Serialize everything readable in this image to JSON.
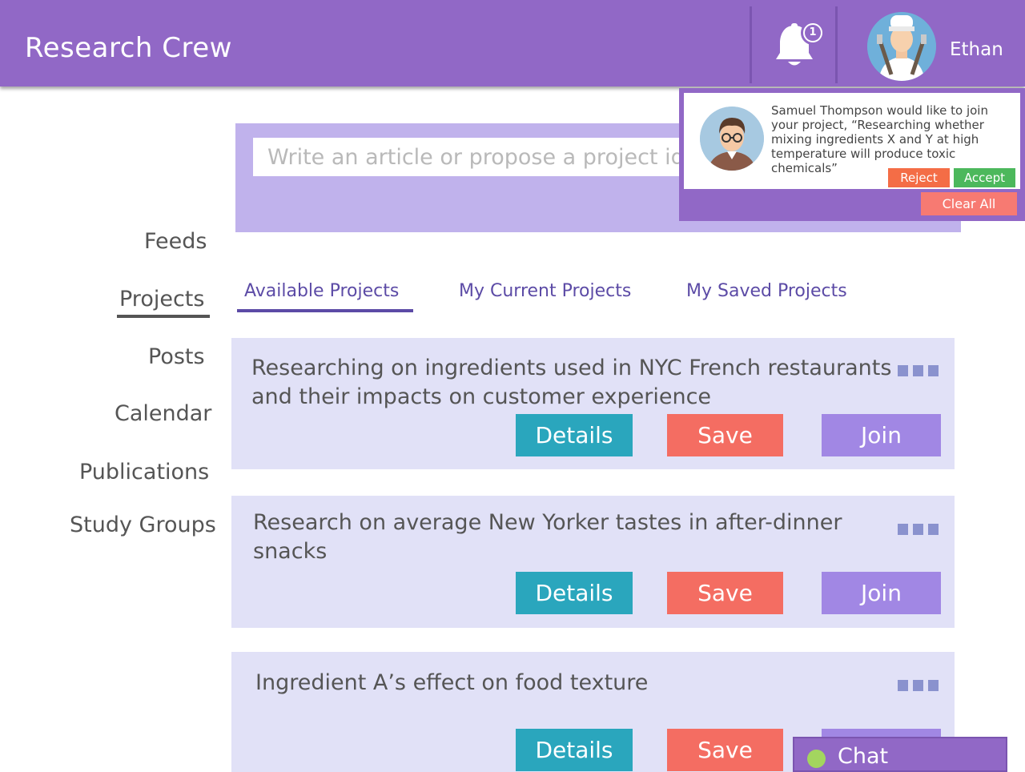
{
  "header": {
    "brand": "Research Crew",
    "notification_count": "1",
    "user_name": "Ethan"
  },
  "composer": {
    "placeholder": "Write an article or propose a project idea"
  },
  "sidebar": {
    "items": [
      {
        "label": "Feeds"
      },
      {
        "label": "Projects",
        "active": true
      },
      {
        "label": "Posts"
      },
      {
        "label": "Calendar"
      },
      {
        "label": "Publications"
      },
      {
        "label": "Study Groups"
      }
    ]
  },
  "tabs": [
    {
      "label": "Available Projects",
      "active": true
    },
    {
      "label": "My Current Projects"
    },
    {
      "label": "My Saved Projects"
    }
  ],
  "projects": [
    {
      "title": "Researching on ingredients used in NYC French restaurants and their impacts on customer experience",
      "details": "Details",
      "save": "Save",
      "join": "Join"
    },
    {
      "title": "Research on average New Yorker tastes in after-dinner snacks",
      "details": "Details",
      "save": "Save",
      "join": "Join"
    },
    {
      "title": "Ingredient A’s effect on food texture",
      "details": "Details",
      "save": "Save",
      "join": "Join"
    }
  ],
  "notification": {
    "message": "Samuel Thompson would like to join your project, “Researching whether mixing ingredients X and Y at high temperature will produce toxic chemicals”",
    "reject": "Reject",
    "accept": "Accept",
    "clear_all": "Clear All"
  },
  "chat": {
    "label": "Chat",
    "status_color": "#a3d55f"
  },
  "colors": {
    "header": "#9168c6",
    "details_button": "#2aa6bd",
    "save_button": "#f46d62",
    "join_button": "#a187e4",
    "card_bg": "#e1e1f7",
    "composer_bg": "#c0b2ec",
    "tab_text": "#5c4ba6"
  }
}
